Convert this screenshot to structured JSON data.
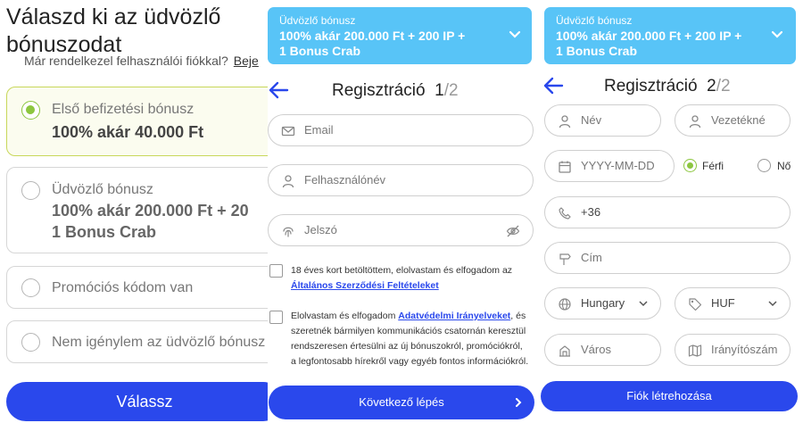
{
  "panel1": {
    "title_line1": "Válaszd ki az üdvözlő",
    "title_line2": "bónuszodat",
    "existing_account_text": "Már rendelkezel felhasználói fiókkal?",
    "login_link": "Beje",
    "options": [
      {
        "line1": "Első befizetési bónusz",
        "line2": "100% akár 40.000 Ft",
        "selected": true
      },
      {
        "line1": "Üdvözlő bónusz",
        "line2": "100% akár 200.000 Ft + 20",
        "line3": "1 Bonus Crab",
        "selected": false
      },
      {
        "line1": "Promóciós kódom van",
        "selected": false
      },
      {
        "line1": "Nem igénylem az üdvözlő bónusz",
        "selected": false
      }
    ],
    "choose_button": "Válassz"
  },
  "panel2": {
    "banner_label": "Üdvözlő bónusz",
    "banner_value_line1": "100% akár 200.000 Ft + 200 IP +",
    "banner_value_line2": "1 Bonus Crab",
    "title": "Regisztráció",
    "step_current": "1",
    "step_total": "/2",
    "email_placeholder": "Email",
    "username_placeholder": "Felhasználónév",
    "password_placeholder": "Jelszó",
    "terms_text": "18 éves kort betöltöttem, elolvastam és elfogadom az",
    "terms_link": "Általános Szerződési Feltételeket",
    "privacy_prefix": "Elolvastam és elfogadom",
    "privacy_link": "Adatvédelmi Irányelveket",
    "privacy_suffix": ", és",
    "privacy_line2": "szeretnék bármilyen kommunikációs csatornán keresztül",
    "privacy_line3": "rendszeresen értesülni az új bónuszokról, promóciókról,",
    "privacy_line4": "a legfontosabb hírekről vagy egyéb fontos információkról.",
    "next_button": "Következő lépés"
  },
  "panel3": {
    "banner_label": "Üdvözlő bónusz",
    "banner_value_line1": "100% akár 200.000 Ft + 200 IP +",
    "banner_value_line2": "1 Bonus Crab",
    "title": "Regisztráció",
    "step_current": "2",
    "step_total": "/2",
    "first_name_placeholder": "Név",
    "last_name_placeholder": "Vezetékné",
    "birthdate_placeholder": "YYYY-MM-DD",
    "gender_male": "Férfi",
    "gender_female": "Nő",
    "phone_value": "+36",
    "address_placeholder": "Cím",
    "country_value": "Hungary",
    "currency_value": "HUF",
    "city_placeholder": "Város",
    "zip_placeholder": "Irányítószám",
    "create_button": "Fiók létrehozása"
  },
  "colors": {
    "primary_blue": "#2a48ec",
    "banner_blue": "#58c4f7",
    "selected_green": "#8cc63f"
  }
}
